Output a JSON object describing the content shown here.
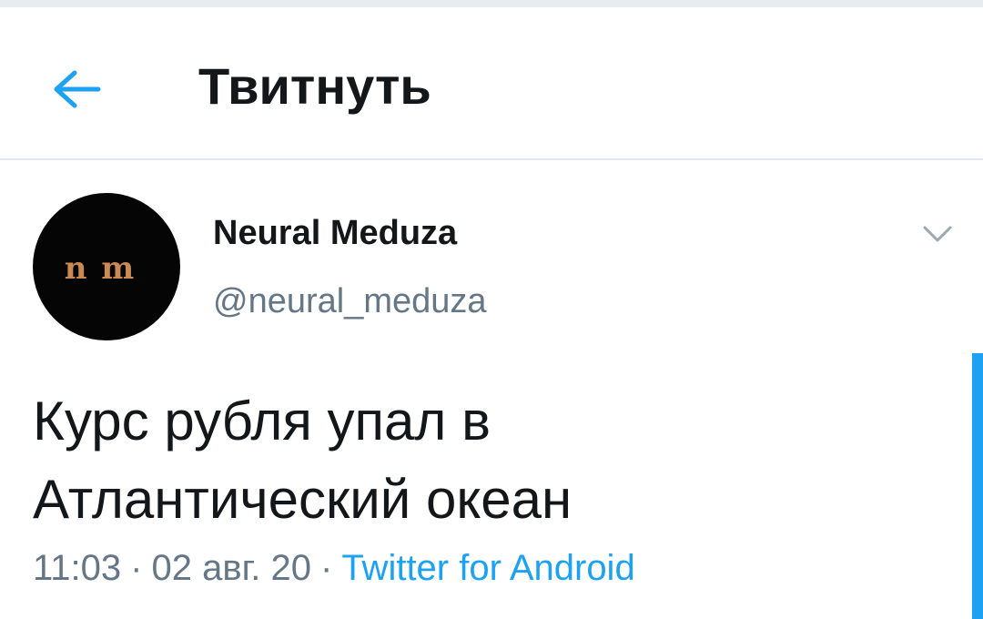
{
  "header": {
    "title": "Твитнуть",
    "back_icon": "arrow-left-icon"
  },
  "tweet": {
    "avatar_logo": "n m",
    "display_name": "Neural Meduza",
    "handle": "@neural_meduza",
    "text_line1": "Курс рубля упал в",
    "text_line2": "Атлантический океан",
    "time": "11:03",
    "date": "02 авг. 20",
    "source": "Twitter for Android",
    "separator": "·"
  },
  "colors": {
    "accent": "#1da1f2",
    "secondary_text": "#657786",
    "primary_text": "#14171a",
    "avatar_bg": "#050505",
    "avatar_logo": "#c98a53"
  }
}
